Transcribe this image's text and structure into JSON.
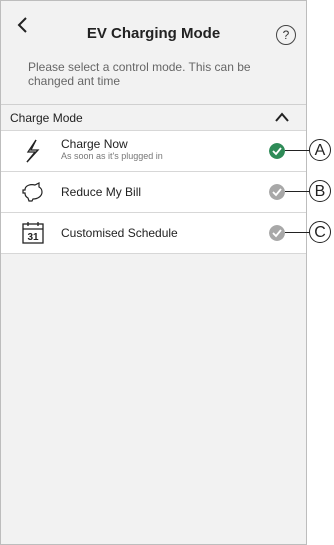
{
  "header": {
    "title": "EV Charging Mode",
    "help_label": "?"
  },
  "description": "Please select a control mode. This can be changed ant time",
  "section": {
    "label": "Charge Mode"
  },
  "options": [
    {
      "label": "Charge Now",
      "sublabel": "As soon as it's plugged in",
      "icon": "lightning-icon",
      "selected": true,
      "callout": "A"
    },
    {
      "label": "Reduce My Bill",
      "icon": "piggy-bank-icon",
      "selected": false,
      "callout": "B"
    },
    {
      "label": "Customised Schedule",
      "icon": "calendar-icon",
      "selected": false,
      "callout": "C"
    }
  ],
  "colors": {
    "selected": "#2e8b57",
    "unselected": "#a8a8a8"
  }
}
